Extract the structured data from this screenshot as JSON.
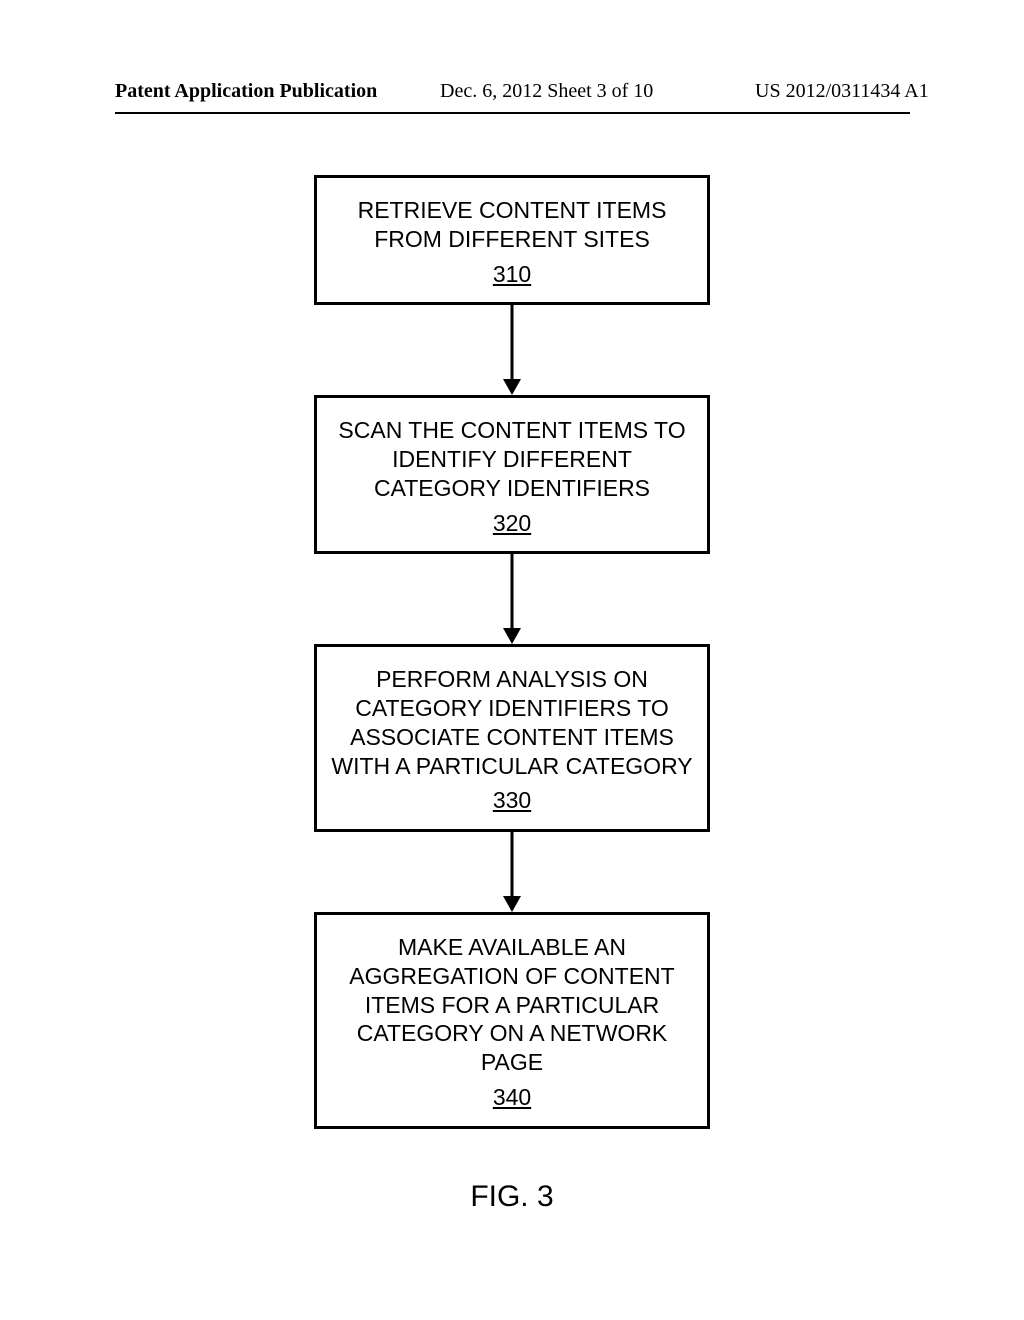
{
  "header": {
    "left": "Patent Application Publication",
    "mid": "Dec. 6, 2012  Sheet 3 of 10",
    "right": "US 2012/0311434 A1"
  },
  "boxes": {
    "b1_text": "RETRIEVE CONTENT ITEMS FROM DIFFERENT SITES",
    "b1_num": "310",
    "b2_text": "SCAN THE CONTENT ITEMS TO IDENTIFY DIFFERENT CATEGORY IDENTIFIERS",
    "b2_num": "320",
    "b3_text": "PERFORM ANALYSIS ON CATEGORY IDENTIFIERS TO ASSOCIATE CONTENT ITEMS WITH A PARTICULAR CATEGORY",
    "b3_num": "330",
    "b4_text": "MAKE AVAILABLE AN AGGREGATION OF CONTENT ITEMS FOR A PARTICULAR CATEGORY ON A NETWORK PAGE",
    "b4_num": "340"
  },
  "figure_label": "FIG. 3"
}
